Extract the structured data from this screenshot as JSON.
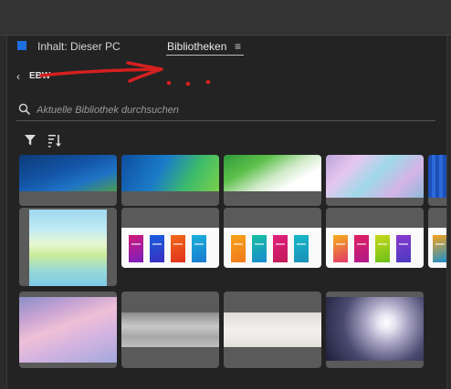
{
  "tabs": {
    "content_label": "Inhalt: Dieser PC",
    "libraries_label": "Bibliotheken",
    "menu_glyph": "≡"
  },
  "breadcrumb": {
    "back_glyph": "‹",
    "label": "EBW"
  },
  "search": {
    "placeholder": "Aktuelle Bibliothek durchsuchen",
    "value": ""
  },
  "toolbar": {
    "filter_icon": "filter-icon",
    "sort_icon": "sort-icon"
  },
  "colors": {
    "accent": "#1f6fe0",
    "panel": "#232323",
    "card": "#5a5a5a",
    "annotation_red": "#d42020"
  },
  "library_items": [
    {
      "name": "blue-wave-dark"
    },
    {
      "name": "blue-green-wave"
    },
    {
      "name": "green-white-wave"
    },
    {
      "name": "pastel-swirl"
    },
    {
      "name": "blue-stripes"
    },
    {
      "name": "pastel-watercolor"
    },
    {
      "name": "gradient-cards-purple"
    },
    {
      "name": "gradient-cards-orange"
    },
    {
      "name": "gradient-cards-mixed"
    },
    {
      "name": "gradient-card-partial"
    },
    {
      "name": "pink-clouds"
    },
    {
      "name": "silver-texture"
    },
    {
      "name": "white-texture"
    },
    {
      "name": "light-burst"
    }
  ]
}
